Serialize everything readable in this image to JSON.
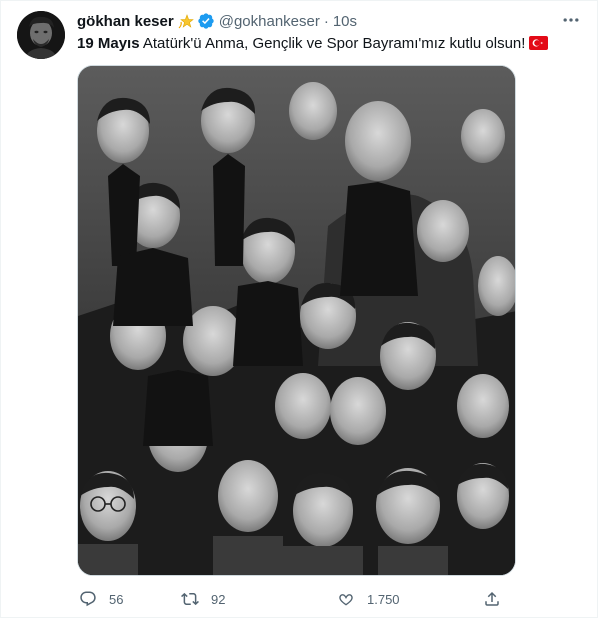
{
  "user": {
    "display_name": "gökhan keser",
    "name_emoji": "dizzy-star-emoji",
    "verified": true,
    "handle": "@gokhankeser",
    "separator": "·",
    "time": "10s",
    "avatar": "profile-photo"
  },
  "tweet": {
    "text_bold": "19 Mayıs",
    "text_rest": " Atatürk'ü Anma, Gençlik ve Spor Bayramı'mız kutlu olsun!",
    "flag": "turkey-flag-emoji",
    "media": "black-and-white group photograph of young people with Atatürk"
  },
  "actions": {
    "reply_count": "56",
    "retweet_count": "92",
    "like_count": "1.750"
  },
  "colors": {
    "text": "#0f1419",
    "secondary": "#536471",
    "verified": "#1d9bf0",
    "border": "#cfd9de",
    "flag_red": "#e30a17"
  }
}
